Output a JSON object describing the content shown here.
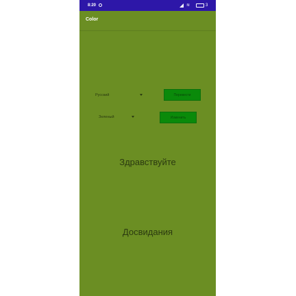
{
  "status_bar": {
    "time": "8:20",
    "battery": "3",
    "background_color": "#2d17a8"
  },
  "app_bar": {
    "title": "Color",
    "background_color": "#6b8e23"
  },
  "controls": {
    "language_spinner": {
      "selected": "Русский",
      "icon": "dropdown-arrow-icon"
    },
    "translate_button": {
      "label": "Перевести"
    },
    "color_spinner": {
      "selected": "Зеленый",
      "icon": "dropdown-arrow-icon"
    },
    "color_button": {
      "label": "Изменить"
    }
  },
  "content": {
    "hello_text": "Здравствуйте",
    "goodbye_text": "Досвидания"
  },
  "colors": {
    "screen_background": "#6b8e23",
    "button_background": "#0a8a0a"
  }
}
